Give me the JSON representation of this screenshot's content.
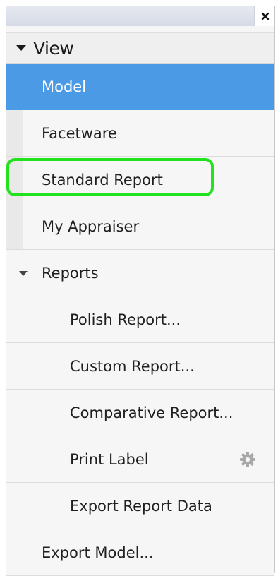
{
  "window": {
    "close_glyph": "×"
  },
  "view_section": {
    "label": "View"
  },
  "items": {
    "model": "Model",
    "facetware": "Facetware",
    "standard_report": "Standard Report",
    "my_appraiser": "My Appraiser",
    "reports": "Reports",
    "polish_report": "Polish Report...",
    "custom_report": "Custom Report...",
    "comparative_report": "Comparative Report...",
    "print_label": "Print Label",
    "export_report_data": "Export Report Data",
    "export_model": "Export Model..."
  },
  "selected_item": "Model",
  "highlighted_item": "Standard Report",
  "icons": {
    "close": "close-icon",
    "view_toggle": "triangle-down-icon",
    "reports_toggle": "triangle-down-icon",
    "print_label_settings": "gear-icon"
  },
  "colors": {
    "selection": "#4a9ae6",
    "highlight_outline": "#21e21d"
  }
}
